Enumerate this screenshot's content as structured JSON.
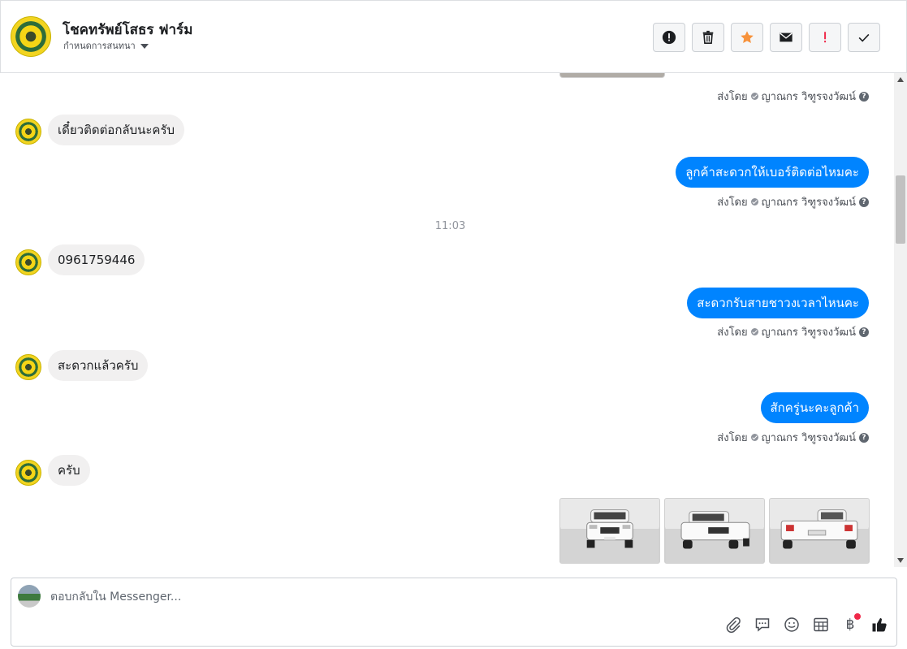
{
  "header": {
    "title": "โชคทรัพย์โสธร ฟาร์ม",
    "subtitle": "กำหนดการสนทนา",
    "actions": [
      {
        "name": "report-icon"
      },
      {
        "name": "trash-icon"
      },
      {
        "name": "star-icon"
      },
      {
        "name": "mail-icon"
      },
      {
        "name": "important-icon"
      },
      {
        "name": "check-icon"
      }
    ],
    "accent_star": "#f7923b",
    "accent_important": "#f02849"
  },
  "thread": {
    "sent_by_prefix": "ส่งโดย",
    "agent_name": "ญาณกร วิฑูรจงวัฒน์",
    "messages": [
      {
        "dir": "in",
        "text": "เดี๋ยวติดต่อกลับนะครับ"
      },
      {
        "dir": "out",
        "text": "ลูกค้าสะดวกให้เบอร์ติดต่อไหมคะ"
      },
      {
        "dir": "time",
        "text": "11:03"
      },
      {
        "dir": "in",
        "text": "0961759446"
      },
      {
        "dir": "out",
        "text": "สะดวกรับสายชาวงเวลาไหนคะ"
      },
      {
        "dir": "in",
        "text": "สะดวกแล้วครับ"
      },
      {
        "dir": "out",
        "text": "สักครู่นะคะลูกค้า"
      },
      {
        "dir": "in",
        "text": "ครับ"
      }
    ],
    "outgoing_color": "#0084ff",
    "incoming_color": "#f1f0f0",
    "photo_count": 3
  },
  "composer": {
    "placeholder": "ตอบกลับใน Messenger...",
    "tools": [
      "attach-icon",
      "saved-reply-icon",
      "emoji-icon",
      "table-icon",
      "baht-icon",
      "like-icon"
    ],
    "baht_symbol": "฿"
  }
}
